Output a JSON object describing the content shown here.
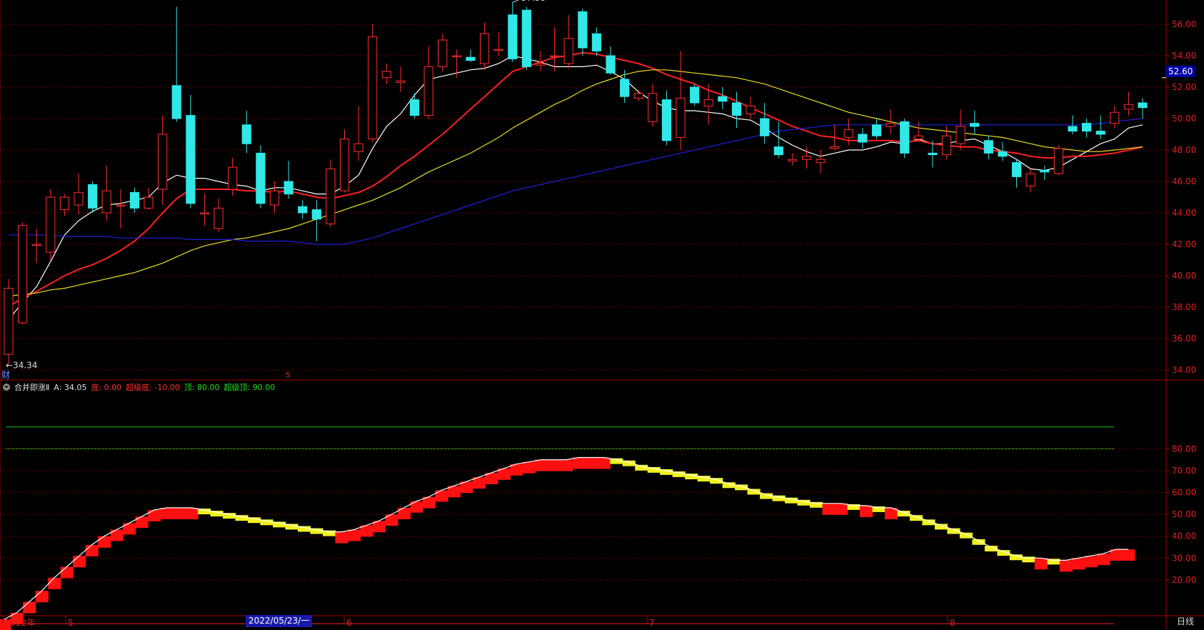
{
  "chart_data": [
    {
      "type": "candlestick",
      "title": "",
      "ylim": [
        33,
        58
      ],
      "y_ticks": [
        "56.00",
        "54.00",
        "52.00",
        "50.00",
        "48.00",
        "46.00",
        "44.00",
        "42.00",
        "40.00",
        "38.00",
        "36.00",
        "34.00"
      ],
      "annotations": {
        "high": "57.38",
        "low": "34.34",
        "current_price": "52.60"
      },
      "candles": [
        [
          35.0,
          39.2,
          34.3,
          39.8
        ],
        [
          37.0,
          43.2,
          36.9,
          43.4
        ],
        [
          42.0,
          42.0,
          40.8,
          43.0
        ],
        [
          41.5,
          45.0,
          41.0,
          45.5
        ],
        [
          44.2,
          45.0,
          43.8,
          45.2
        ],
        [
          44.5,
          45.3,
          43.9,
          46.5
        ],
        [
          45.8,
          44.3,
          44.0,
          46.0
        ],
        [
          44.0,
          45.4,
          43.5,
          47.0
        ],
        [
          44.5,
          44.5,
          43.0,
          45.5
        ],
        [
          45.3,
          44.3,
          44.0,
          45.6
        ],
        [
          44.3,
          45.0,
          44.2,
          45.6
        ],
        [
          45.5,
          49.0,
          44.5,
          50.2
        ],
        [
          52.1,
          50.0,
          49.8,
          57.1
        ],
        [
          50.2,
          44.6,
          44.3,
          51.5
        ],
        [
          44.0,
          44.0,
          43.2,
          45.2
        ],
        [
          43.0,
          44.3,
          42.8,
          44.9
        ],
        [
          45.5,
          46.9,
          45.1,
          47.5
        ],
        [
          49.6,
          48.4,
          47.8,
          50.5
        ],
        [
          47.8,
          44.6,
          44.3,
          48.3
        ],
        [
          44.5,
          45.4,
          44.0,
          46.0
        ],
        [
          46.0,
          45.2,
          44.9,
          47.3
        ],
        [
          44.4,
          44.0,
          43.6,
          44.8
        ],
        [
          44.2,
          43.6,
          42.2,
          44.8
        ],
        [
          43.3,
          46.8,
          43.1,
          47.4
        ],
        [
          45.4,
          48.7,
          45.3,
          49.3
        ],
        [
          47.9,
          48.4,
          47.3,
          50.8
        ],
        [
          48.7,
          55.2,
          48.5,
          56.0
        ],
        [
          52.6,
          53.0,
          52.2,
          53.5
        ],
        [
          52.3,
          52.4,
          51.7,
          53.3
        ],
        [
          51.2,
          50.2,
          50.0,
          51.6
        ],
        [
          50.2,
          53.3,
          50.0,
          54.6
        ],
        [
          53.3,
          55.0,
          53.0,
          55.4
        ],
        [
          54.0,
          54.0,
          52.6,
          54.4
        ],
        [
          53.9,
          53.7,
          53.6,
          54.4
        ],
        [
          53.5,
          55.4,
          53.1,
          56.1
        ],
        [
          54.4,
          54.4,
          54.0,
          55.5
        ],
        [
          56.6,
          53.8,
          53.6,
          57.4
        ],
        [
          56.9,
          53.3,
          53.1,
          57.1
        ],
        [
          53.4,
          53.5,
          53.0,
          54.3
        ],
        [
          54.0,
          54.0,
          53.0,
          55.8
        ],
        [
          53.5,
          55.1,
          53.2,
          56.6
        ],
        [
          56.8,
          54.5,
          54.0,
          57.0
        ],
        [
          55.4,
          54.3,
          54.0,
          55.8
        ],
        [
          54.0,
          52.9,
          52.8,
          54.6
        ],
        [
          52.5,
          51.4,
          51.0,
          53.1
        ],
        [
          51.3,
          51.6,
          51.1,
          51.8
        ],
        [
          49.8,
          51.6,
          49.5,
          52.2
        ],
        [
          51.2,
          48.6,
          48.3,
          51.8
        ],
        [
          48.8,
          51.3,
          48.0,
          54.3
        ],
        [
          52.0,
          51.0,
          50.8,
          52.2
        ],
        [
          50.8,
          51.2,
          49.6,
          52.2
        ],
        [
          51.4,
          51.1,
          50.6,
          52.0
        ],
        [
          51.0,
          50.2,
          49.4,
          51.7
        ],
        [
          50.3,
          50.8,
          50.0,
          51.4
        ],
        [
          50.0,
          48.9,
          48.4,
          51.0
        ],
        [
          48.2,
          47.7,
          47.5,
          49.8
        ],
        [
          47.3,
          47.4,
          47.0,
          47.8
        ],
        [
          47.4,
          47.6,
          46.8,
          48.2
        ],
        [
          47.2,
          47.4,
          46.5,
          48.0
        ],
        [
          48.1,
          48.2,
          48.0,
          49.6
        ],
        [
          48.8,
          49.3,
          48.3,
          50.0
        ],
        [
          49.0,
          48.5,
          48.1,
          49.4
        ],
        [
          49.6,
          48.9,
          48.7,
          50.0
        ],
        [
          49.5,
          49.7,
          49.0,
          50.6
        ],
        [
          49.8,
          47.8,
          47.5,
          50.0
        ],
        [
          48.7,
          48.9,
          48.5,
          49.8
        ],
        [
          47.8,
          47.7,
          46.9,
          48.6
        ],
        [
          47.7,
          48.9,
          47.4,
          49.5
        ],
        [
          48.4,
          49.5,
          48.0,
          50.6
        ],
        [
          49.7,
          49.5,
          49.0,
          50.5
        ],
        [
          48.6,
          47.8,
          47.4,
          48.9
        ],
        [
          47.9,
          47.6,
          47.3,
          48.5
        ],
        [
          47.2,
          46.3,
          45.6,
          47.4
        ],
        [
          45.7,
          46.5,
          45.3,
          46.8
        ],
        [
          46.7,
          46.6,
          46.1,
          47.0
        ],
        [
          46.5,
          48.1,
          46.4,
          48.3
        ],
        [
          49.5,
          49.2,
          49.0,
          50.2
        ],
        [
          49.7,
          49.2,
          48.8,
          50.0
        ],
        [
          49.2,
          49.0,
          48.7,
          50.2
        ],
        [
          49.7,
          50.4,
          49.4,
          50.8
        ],
        [
          50.6,
          50.9,
          50.2,
          51.7
        ],
        [
          51.0,
          50.7,
          50.0,
          51.3
        ]
      ],
      "ma_series": [
        {
          "color": "#ffffff",
          "values": [
            37.2,
            38.3,
            39.3,
            40.9,
            42.6,
            43.5,
            44.1,
            44.5,
            44.6,
            44.8,
            45.0,
            45.9,
            46.4,
            46.2,
            46.2,
            46.0,
            45.8,
            45.7,
            45.4,
            45.6,
            45.6,
            45.4,
            45.2,
            45.2,
            45.7,
            46.4,
            48.1,
            49.5,
            50.3,
            51.5,
            52.5,
            52.7,
            52.9,
            53.1,
            53.2,
            53.5,
            54.0,
            53.8,
            53.6,
            53.3,
            53.3,
            53.3,
            53.4,
            53.0,
            52.5,
            51.7,
            51.1,
            50.7,
            50.5,
            50.5,
            50.4,
            50.3,
            50.0,
            49.9,
            49.4,
            48.8,
            48.3,
            47.9,
            47.6,
            47.8,
            48.0,
            48.0,
            48.2,
            48.5,
            48.4,
            48.7,
            48.4,
            48.4,
            48.6,
            48.7,
            48.3,
            47.9,
            47.4,
            46.8,
            46.7,
            46.9,
            47.4,
            47.9,
            48.4,
            48.7,
            49.4,
            49.6
          ]
        },
        {
          "color": "#ff2020",
          "values": [
            38.0,
            38.6,
            39.0,
            39.5,
            40.0,
            40.4,
            40.7,
            41.1,
            41.6,
            42.2,
            43.0,
            44.0,
            44.9,
            45.5,
            45.5,
            45.5,
            45.5,
            45.4,
            45.4,
            45.3,
            45.4,
            45.2,
            45.0,
            44.9,
            45.1,
            45.3,
            45.7,
            46.3,
            47.0,
            47.6,
            48.3,
            49.0,
            49.8,
            50.6,
            51.4,
            52.2,
            53.0,
            53.3,
            53.6,
            53.9,
            54.0,
            54.2,
            54.1,
            53.9,
            53.7,
            53.5,
            53.2,
            52.8,
            52.5,
            52.2,
            51.8,
            51.5,
            51.1,
            50.7,
            50.3,
            49.9,
            49.5,
            49.2,
            48.9,
            48.8,
            48.6,
            48.6,
            48.6,
            48.6,
            48.5,
            48.6,
            48.4,
            48.3,
            48.2,
            48.2,
            48.0,
            47.9,
            47.8,
            47.6,
            47.5,
            47.5,
            47.6,
            47.6,
            47.7,
            47.8,
            48.0,
            48.2
          ]
        },
        {
          "color": "#e8e020",
          "values": [
            38.7,
            38.8,
            38.9,
            39.1,
            39.2,
            39.4,
            39.6,
            39.8,
            40.0,
            40.2,
            40.5,
            40.8,
            41.2,
            41.6,
            41.9,
            42.1,
            42.3,
            42.4,
            42.6,
            42.8,
            43.0,
            43.3,
            43.6,
            43.9,
            44.2,
            44.5,
            44.8,
            45.2,
            45.6,
            46.1,
            46.6,
            47.0,
            47.4,
            47.8,
            48.3,
            48.8,
            49.4,
            49.9,
            50.4,
            50.9,
            51.3,
            51.8,
            52.2,
            52.5,
            52.8,
            53.0,
            53.1,
            53.1,
            53.0,
            52.9,
            52.8,
            52.7,
            52.6,
            52.4,
            52.2,
            51.9,
            51.6,
            51.3,
            51.0,
            50.7,
            50.4,
            50.2,
            50.0,
            49.8,
            49.6,
            49.4,
            49.3,
            49.2,
            49.1,
            49.0,
            48.9,
            48.8,
            48.6,
            48.4,
            48.2,
            48.1,
            48.0,
            47.9,
            47.9,
            48.0,
            48.1,
            48.2
          ]
        },
        {
          "color": "#2020e0",
          "values": [
            42.6,
            42.6,
            42.6,
            42.6,
            42.5,
            42.5,
            42.5,
            42.5,
            42.4,
            42.4,
            42.4,
            42.4,
            42.4,
            42.3,
            42.3,
            42.3,
            42.3,
            42.2,
            42.2,
            42.2,
            42.2,
            42.1,
            42.0,
            42.0,
            42.0,
            42.2,
            42.4,
            42.7,
            43.0,
            43.3,
            43.6,
            43.9,
            44.2,
            44.5,
            44.8,
            45.1,
            45.4,
            45.6,
            45.8,
            46.0,
            46.2,
            46.4,
            46.6,
            46.8,
            47.0,
            47.2,
            47.4,
            47.6,
            47.8,
            48.0,
            48.2,
            48.4,
            48.6,
            48.8,
            49.0,
            49.2,
            49.3,
            49.4,
            49.5,
            49.6,
            49.6,
            49.6,
            49.6,
            49.6,
            49.6,
            49.6,
            49.6,
            49.6,
            49.6,
            49.6,
            49.6,
            49.6,
            49.6,
            49.6,
            49.6,
            49.6,
            49.6,
            49.6,
            49.7,
            49.8,
            49.9,
            50.0
          ]
        }
      ]
    },
    {
      "type": "line",
      "title": "合并即涨Ⅱ",
      "legend": [
        {
          "label": "A: 34.05",
          "color": "#e0e0e0"
        },
        {
          "label": "底: 0.00",
          "color": "#ff2020"
        },
        {
          "label": "超级底: -10.00",
          "color": "#ff2020"
        },
        {
          "label": "顶: 80.00",
          "color": "#20e020"
        },
        {
          "label": "超级顶: 90.00",
          "color": "#20e020"
        }
      ],
      "ylim": [
        -13,
        97
      ],
      "y_ticks": [
        "80.00",
        "70.00",
        "60.00",
        "50.00",
        "40.00",
        "30.00",
        "20.00"
      ],
      "reference_lines": [
        {
          "value": 90,
          "color": "#20c020"
        },
        {
          "value": 80,
          "color": "#20c020"
        },
        {
          "value": 0,
          "color": "#ff2020"
        },
        {
          "value": -10,
          "color": "#ff2020"
        }
      ],
      "values": [
        2,
        5,
        10,
        15,
        21,
        26,
        31,
        36,
        40,
        43,
        46,
        49,
        52,
        53,
        53,
        53,
        52,
        51,
        50,
        49,
        48,
        47,
        46,
        45,
        44,
        43,
        42,
        42,
        43,
        45,
        47,
        50,
        53,
        56,
        58,
        61,
        63,
        65,
        67,
        69,
        71,
        73,
        74,
        75,
        75,
        75,
        76,
        76,
        76,
        75,
        74,
        72,
        71,
        70,
        69,
        68,
        67,
        66,
        64,
        63,
        61,
        59,
        58,
        57,
        56,
        55,
        55,
        55,
        54,
        54,
        53,
        53,
        51,
        49,
        47,
        45,
        43,
        41,
        38,
        35,
        33,
        31,
        30,
        30,
        29,
        29,
        30,
        31,
        32,
        34,
        34
      ]
    }
  ],
  "x_axis": {
    "labels": [
      "2022年",
      "5",
      "6",
      "7",
      "8"
    ]
  },
  "ui": {
    "cai": "财",
    "selected_date": "2022/05/23/一",
    "period": "日线",
    "dividend_mark": "S"
  }
}
